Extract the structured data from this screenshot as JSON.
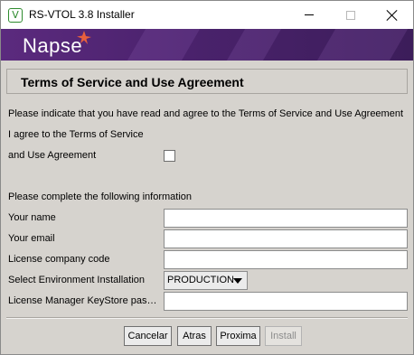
{
  "window": {
    "title": "RS-VTOL 3.8 Installer",
    "icon_letter": "V",
    "brand": "Napse"
  },
  "header": {
    "title": "Terms of Service and Use Agreement"
  },
  "terms": {
    "instruction": "Please indicate that you have read and agree to the Terms of Service and Use Agreement",
    "agree_line1": "I agree to the Terms of Service",
    "agree_line2": "and Use Agreement",
    "agree_checked": false
  },
  "info": {
    "instruction": "Please complete the following information",
    "name_label": "Your name",
    "name_value": "",
    "email_label": "Your email",
    "email_value": "",
    "license_label": "License company code",
    "license_value": "",
    "env_label": "Select Environment Installation",
    "env_value": "PRODUCTION",
    "keystore_label": "License Manager KeyStore pas…",
    "keystore_value": ""
  },
  "buttons": {
    "cancel": "Cancelar",
    "back": "Atras",
    "next": "Proxima",
    "install": "Install"
  },
  "colors": {
    "banner": "#4a226c",
    "accent_star": "#e8603c",
    "window_bg": "#d6d3ce"
  }
}
